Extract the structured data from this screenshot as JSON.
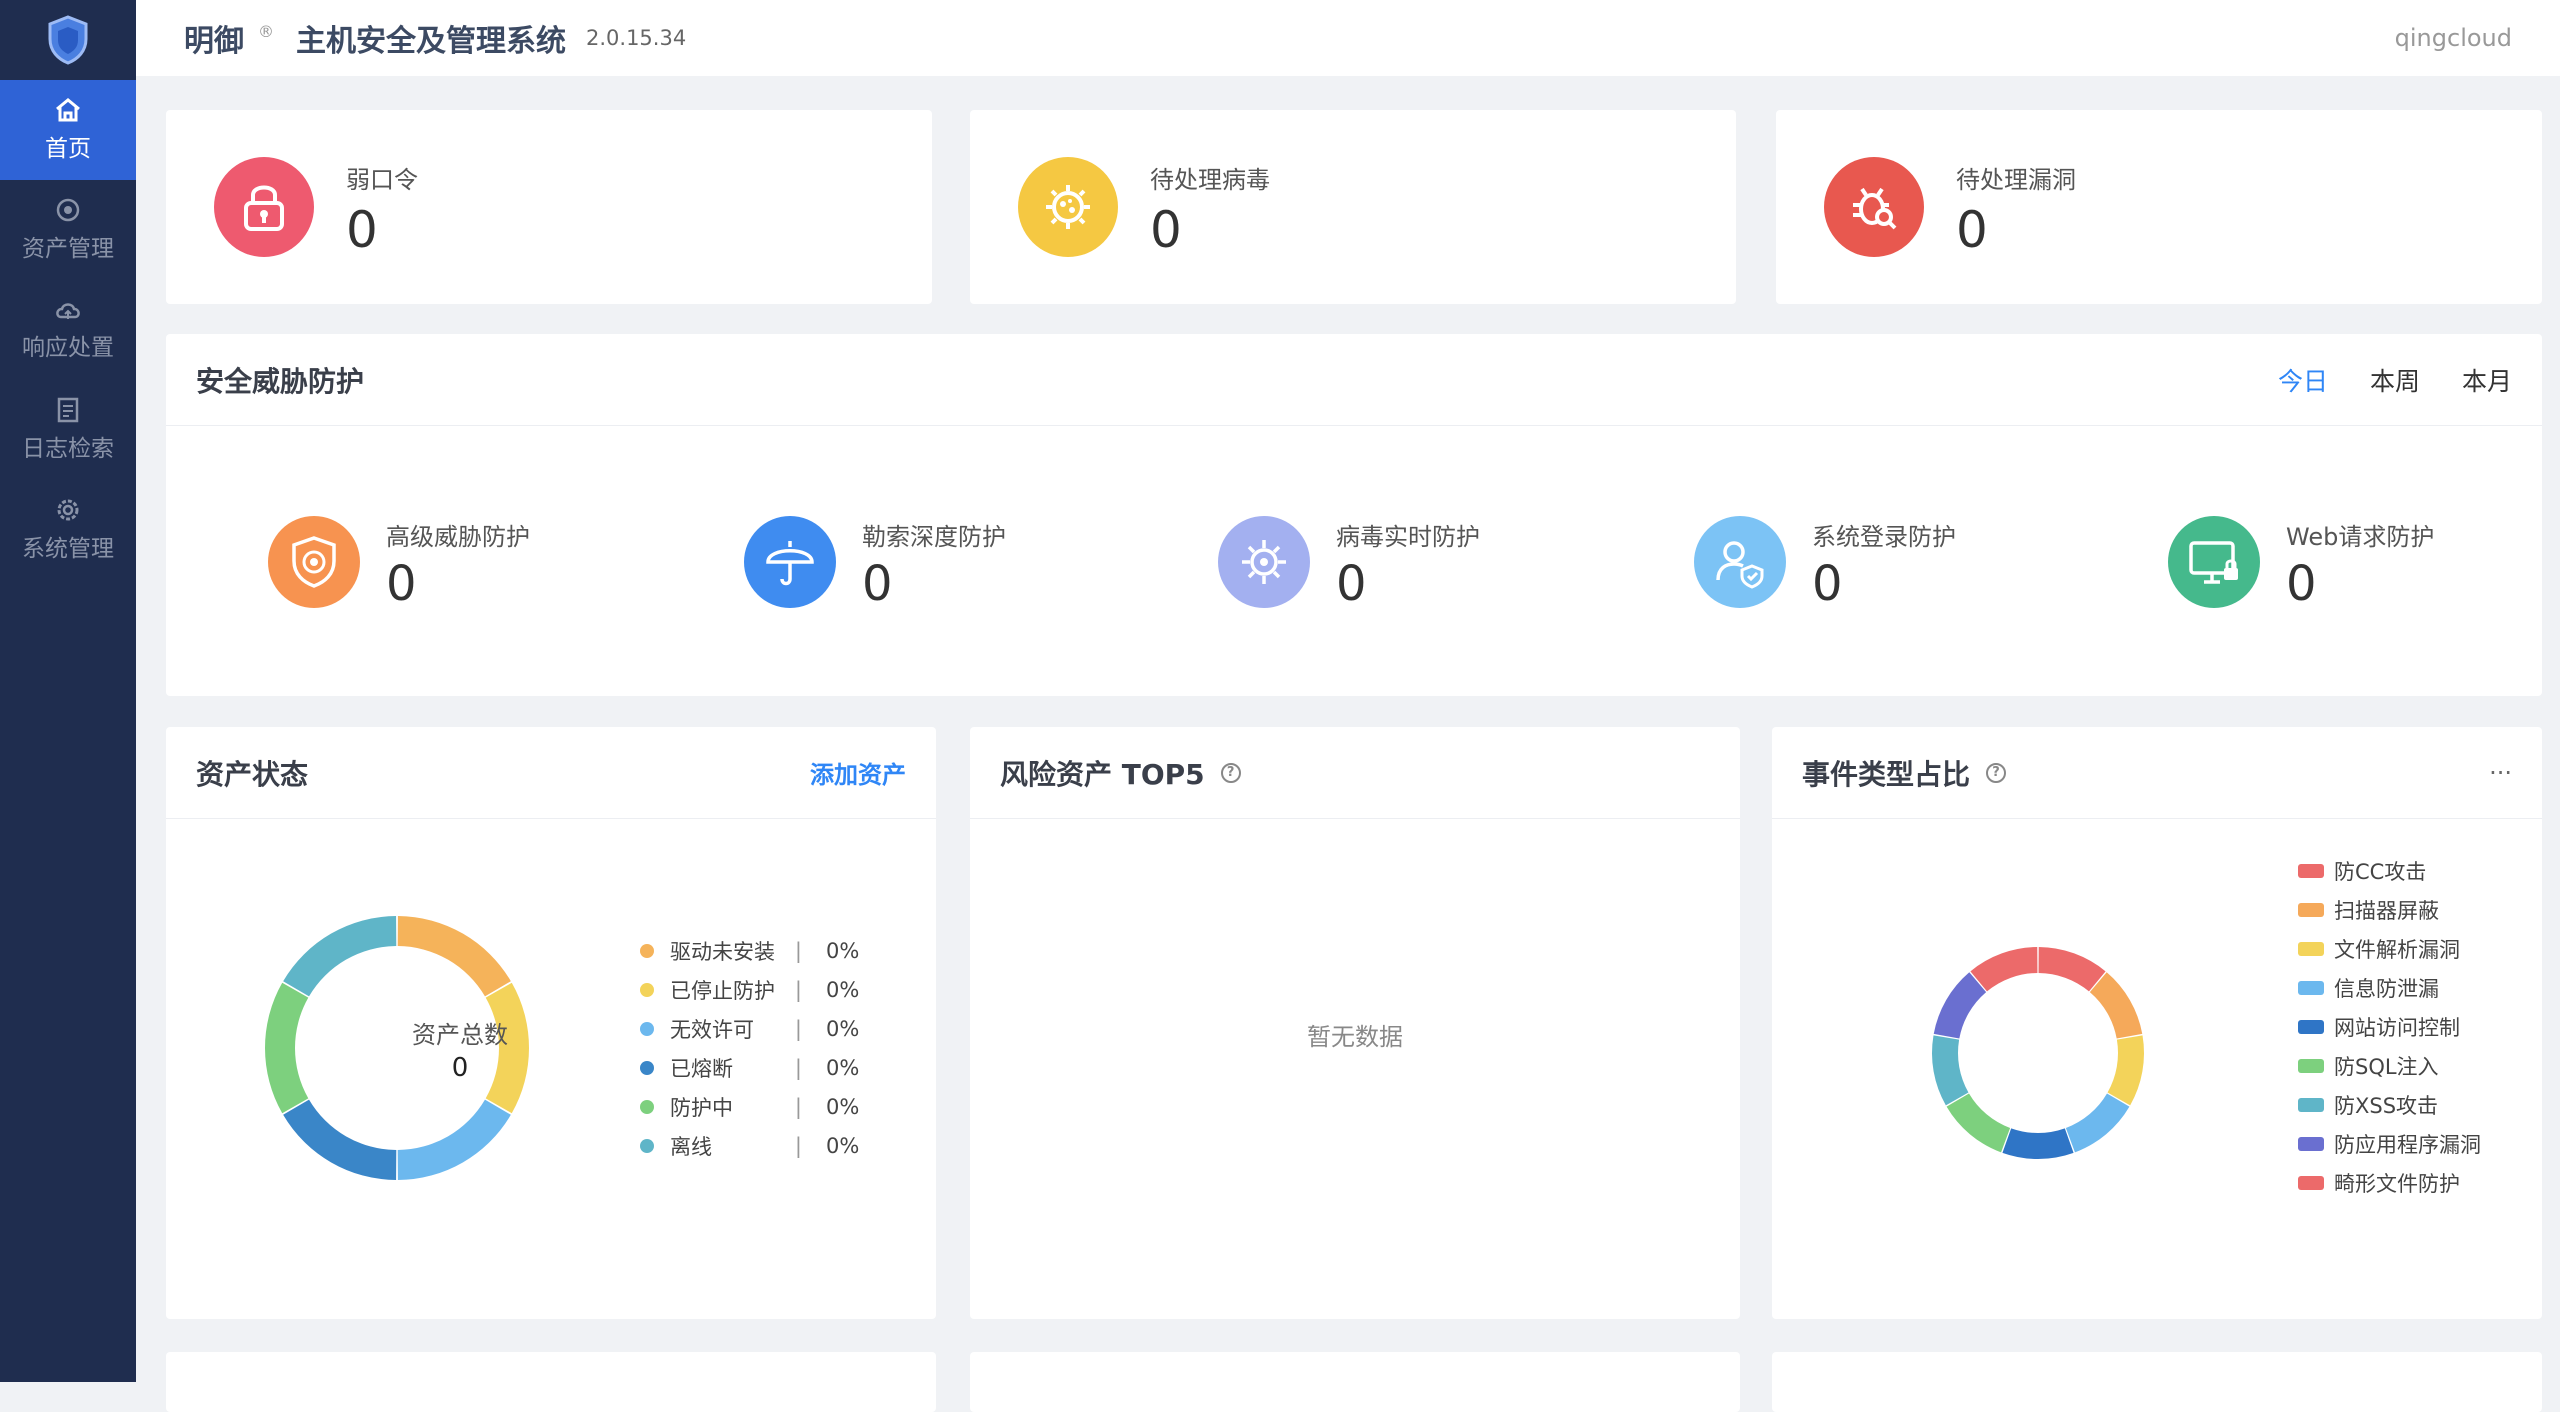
{
  "header": {
    "brand": "明御",
    "reg_mark": "®",
    "system_title": "主机安全及管理系统",
    "version": "2.0.15.34",
    "user": "qingcloud"
  },
  "sidebar": {
    "items": [
      {
        "label": "首页",
        "icon": "home-icon",
        "active": true
      },
      {
        "label": "资产管理",
        "icon": "asset-icon",
        "active": false
      },
      {
        "label": "响应处置",
        "icon": "cloud-icon",
        "active": false
      },
      {
        "label": "日志检索",
        "icon": "log-icon",
        "active": false
      },
      {
        "label": "系统管理",
        "icon": "gear-icon",
        "active": false
      }
    ]
  },
  "stats": [
    {
      "label": "弱口令",
      "value": "0",
      "icon": "lock-icon",
      "color": "#ee5a6f"
    },
    {
      "label": "待处理病毒",
      "value": "0",
      "icon": "virus-icon",
      "color": "#f5c842"
    },
    {
      "label": "待处理漏洞",
      "value": "0",
      "icon": "bug-icon",
      "color": "#e8584f"
    }
  ],
  "threat": {
    "title": "安全威胁防护",
    "tabs": [
      "今日",
      "本周",
      "本月"
    ],
    "active_tab": "今日",
    "items": [
      {
        "label": "高级威胁防护",
        "value": "0",
        "icon": "shield-target-icon",
        "color": "#f79350"
      },
      {
        "label": "勒索深度防护",
        "value": "0",
        "icon": "umbrella-icon",
        "color": "#3f8cf0"
      },
      {
        "label": "病毒实时防护",
        "value": "0",
        "icon": "virus-scan-icon",
        "color": "#a3b0f0"
      },
      {
        "label": "系统登录防护",
        "value": "0",
        "icon": "user-shield-icon",
        "color": "#7cc3f5"
      },
      {
        "label": "Web请求防护",
        "value": "0",
        "icon": "monitor-lock-icon",
        "color": "#45b98c"
      }
    ]
  },
  "asset_status": {
    "title": "资产状态",
    "add_link": "添加资产",
    "center_label": "资产总数",
    "center_value": "0",
    "legend": [
      {
        "label": "驱动未安装",
        "pct": "0%",
        "color": "#f5b35a"
      },
      {
        "label": "已停止防护",
        "pct": "0%",
        "color": "#f3d35a"
      },
      {
        "label": "无效许可",
        "pct": "0%",
        "color": "#6cb8ee"
      },
      {
        "label": "已熔断",
        "pct": "0%",
        "color": "#3a86c8"
      },
      {
        "label": "防护中",
        "pct": "0%",
        "color": "#7dd07e"
      },
      {
        "label": "离线",
        "pct": "0%",
        "color": "#5fb5c8"
      }
    ],
    "separator": "|"
  },
  "risk_top5": {
    "title": "风险资产 TOP5",
    "help": "?",
    "empty_text": "暂无数据"
  },
  "event_types": {
    "title": "事件类型占比",
    "help": "?",
    "more": "···",
    "legend": [
      {
        "label": "防CC攻击",
        "color": "#ec6a6a"
      },
      {
        "label": "扫描器屏蔽",
        "color": "#f5a95a"
      },
      {
        "label": "文件解析漏洞",
        "color": "#f3d35a"
      },
      {
        "label": "信息防泄漏",
        "color": "#6cb8ee"
      },
      {
        "label": "网站访问控制",
        "color": "#2f75c6"
      },
      {
        "label": "防SQL注入",
        "color": "#7dd07e"
      },
      {
        "label": "防XSS攻击",
        "color": "#5fb5c8"
      },
      {
        "label": "防应用程序漏洞",
        "color": "#6a6fd0"
      },
      {
        "label": "畸形文件防护",
        "color": "#ec6a6a"
      }
    ]
  }
}
